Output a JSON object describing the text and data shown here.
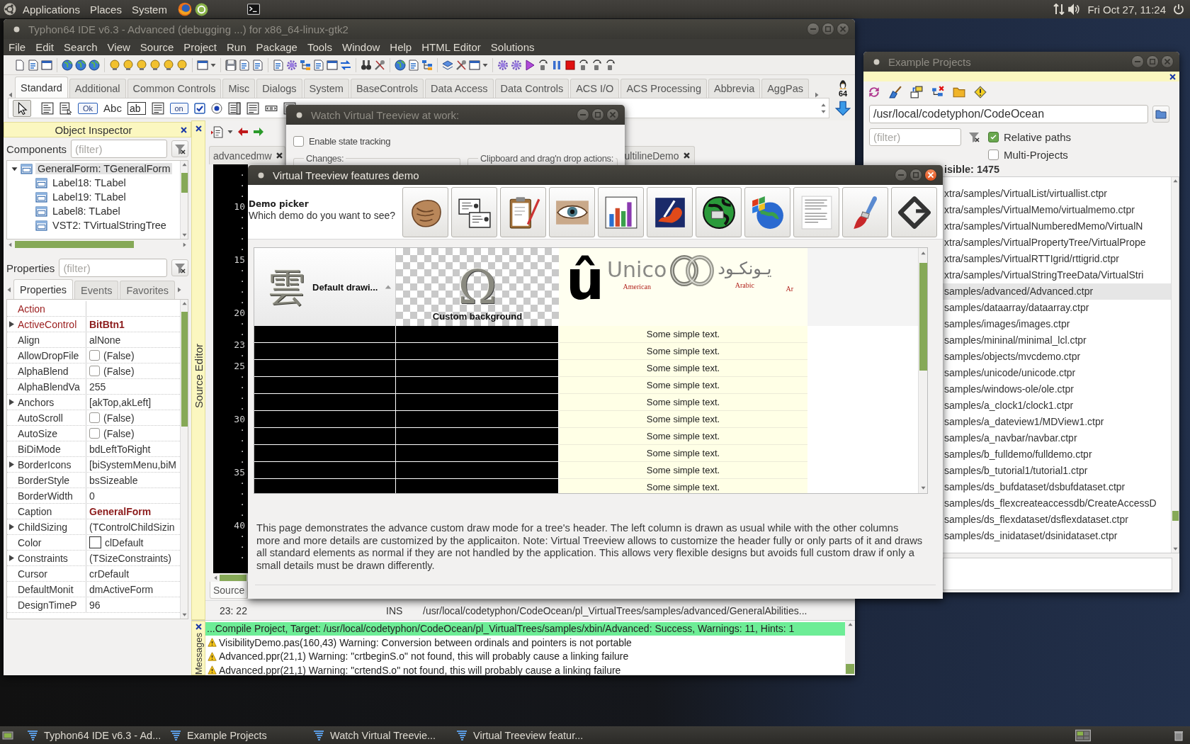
{
  "top_panel": {
    "menus": [
      "Applications",
      "Places",
      "System"
    ],
    "clock": "Fri Oct 27, 11:24"
  },
  "ide": {
    "title": "Typhon64 IDE v6.3 - Advanced (debugging ...) for x86_64-linux-gtk2",
    "active": false,
    "menu": [
      "File",
      "Edit",
      "Search",
      "View",
      "Source",
      "Project",
      "Run",
      "Package",
      "Tools",
      "Window",
      "Help",
      "HTML Editor",
      "Solutions"
    ],
    "palette_tabs": [
      {
        "label": "Standard",
        "selected": true
      },
      {
        "label": "Additional",
        "selected": false
      },
      {
        "label": "Common Controls",
        "selected": false
      },
      {
        "label": "Misc",
        "selected": false
      },
      {
        "label": "Dialogs",
        "selected": false
      },
      {
        "label": "System",
        "selected": false
      },
      {
        "label": "BaseControls",
        "selected": false
      },
      {
        "label": "Data Access",
        "selected": false
      },
      {
        "label": "Data Controls",
        "selected": false
      },
      {
        "label": "ACS I/O",
        "selected": false
      },
      {
        "label": "ACS Processing",
        "selected": false
      },
      {
        "label": "Abbrevia",
        "selected": false
      },
      {
        "label": "AggPas",
        "selected": false
      }
    ],
    "arch_badge": "64",
    "palette_items": [
      {
        "kind": "pointer"
      },
      {
        "kind": "main-menu"
      },
      {
        "kind": "popup-menu"
      },
      {
        "kind": "button",
        "text": "Ok"
      },
      {
        "kind": "label",
        "text": "Abc"
      },
      {
        "kind": "edit",
        "text": "ab"
      },
      {
        "kind": "memo"
      },
      {
        "kind": "toggle",
        "text": "on"
      },
      {
        "kind": "checkbox"
      },
      {
        "kind": "radio"
      },
      {
        "kind": "listbox"
      },
      {
        "kind": "memo"
      },
      {
        "kind": "scrollbar"
      },
      {
        "kind": "panel"
      }
    ],
    "object_inspector": {
      "title": "Object Inspector",
      "components_label": "Components",
      "components_filter": {
        "placeholder": "(filter)"
      },
      "tree": [
        {
          "label": "GeneralForm: TGeneralForm",
          "expanded": true,
          "selected": true,
          "children": [
            {
              "label": "Label18: TLabel",
              "selected": false
            },
            {
              "label": "Label19: TLabel",
              "selected": false
            },
            {
              "label": "Label8: TLabel",
              "selected": false
            },
            {
              "label": "VST2: TVirtualStringTree",
              "selected": false
            }
          ]
        }
      ],
      "properties_label": "Properties",
      "properties_filter": {
        "placeholder": "(filter)"
      },
      "tabs": [
        {
          "label": "Properties",
          "selected": true
        },
        {
          "label": "Events",
          "selected": false
        },
        {
          "label": "Favorites",
          "selected": false
        }
      ],
      "rows": [
        {
          "name": "Action",
          "kind": "text",
          "expandable": false,
          "linked": true,
          "modified": false
        },
        {
          "name": "ActiveControl",
          "value": "BitBtn1",
          "kind": "text",
          "expandable": true,
          "linked": true,
          "modified": true
        },
        {
          "name": "Align",
          "value": "alNone",
          "kind": "text",
          "expandable": false,
          "linked": false,
          "modified": false
        },
        {
          "name": "AllowDropFile",
          "value": "(False)",
          "kind": "checkbox",
          "checked": false,
          "expandable": false,
          "linked": false,
          "modified": false
        },
        {
          "name": "AlphaBlend",
          "value": "(False)",
          "kind": "checkbox",
          "checked": false,
          "expandable": false,
          "linked": false,
          "modified": false
        },
        {
          "name": "AlphaBlendVa",
          "value": "255",
          "kind": "text",
          "expandable": false,
          "linked": false,
          "modified": false
        },
        {
          "name": "Anchors",
          "value": "[akTop,akLeft]",
          "kind": "text",
          "expandable": true,
          "linked": false,
          "modified": false
        },
        {
          "name": "AutoScroll",
          "value": "(False)",
          "kind": "checkbox",
          "checked": false,
          "expandable": false,
          "linked": false,
          "modified": false
        },
        {
          "name": "AutoSize",
          "value": "(False)",
          "kind": "checkbox",
          "checked": false,
          "expandable": false,
          "linked": false,
          "modified": false
        },
        {
          "name": "BiDiMode",
          "value": "bdLeftToRight",
          "kind": "text",
          "expandable": false,
          "linked": false,
          "modified": false
        },
        {
          "name": "BorderIcons",
          "value": "[biSystemMenu,biM",
          "kind": "text",
          "expandable": true,
          "linked": false,
          "modified": false
        },
        {
          "name": "BorderStyle",
          "value": "bsSizeable",
          "kind": "text",
          "expandable": false,
          "linked": false,
          "modified": false
        },
        {
          "name": "BorderWidth",
          "value": "0",
          "kind": "text",
          "expandable": false,
          "linked": false,
          "modified": false
        },
        {
          "name": "Caption",
          "value": "GeneralForm",
          "kind": "text",
          "expandable": false,
          "linked": false,
          "modified": true
        },
        {
          "name": "ChildSizing",
          "value": "(TControlChildSizin",
          "kind": "text",
          "expandable": true,
          "linked": false,
          "modified": false
        },
        {
          "name": "Color",
          "value": "clDefault",
          "kind": "color",
          "expandable": false,
          "linked": false,
          "modified": false
        },
        {
          "name": "Constraints",
          "value": "(TSizeConstraints)",
          "kind": "text",
          "expandable": true,
          "linked": false,
          "modified": false
        },
        {
          "name": "Cursor",
          "value": "crDefault",
          "kind": "text",
          "expandable": false,
          "linked": false,
          "modified": false
        },
        {
          "name": "DefaultMonit",
          "value": "dmActiveForm",
          "kind": "text",
          "expandable": false,
          "linked": false,
          "modified": false
        },
        {
          "name": "DesignTimeP",
          "value": "96",
          "kind": "text",
          "expandable": false,
          "linked": false,
          "modified": false
        }
      ]
    },
    "source_editor": {
      "side_label": "Source Editor",
      "tabs": [
        {
          "label": "advancedmw"
        },
        {
          "label": "ultilineDemo"
        }
      ],
      "gutter": [
        "·",
        "·",
        "·",
        "10",
        "·",
        "·",
        "·",
        "·",
        "15",
        "·",
        "·",
        "·",
        "·",
        "20",
        "·",
        "·",
        "23",
        "·",
        "25",
        "·",
        "·",
        "·",
        "·",
        "30",
        "·",
        "·",
        "·",
        "·",
        "35",
        "·",
        "·",
        "·",
        "·",
        "40",
        "·",
        "·",
        "·"
      ],
      "bottom_tab": "Source",
      "status": {
        "position": "23: 22",
        "mode": "INS",
        "file": "/usr/local/codetyphon/CodeOcean/pl_VirtualTrees/samples/advanced/GeneralAbilities..."
      }
    },
    "messages": {
      "side_label": "Messages",
      "lines": [
        {
          "kind": "success",
          "text": "...Compile Project, Target: /usr/local/codetyphon/CodeOcean/pl_VirtualTrees/samples/xbin/Advanced: Success, Warnings: 11, Hints: 1"
        },
        {
          "kind": "warning",
          "text": "VisibilityDemo.pas(160,43) Warning: Conversion between ordinals and pointers is not portable"
        },
        {
          "kind": "warning",
          "text": "Advanced.ppr(21,1) Warning: \"crtbeginS.o\" not found, this will probably cause a linking failure"
        },
        {
          "kind": "warning",
          "text": "Advanced.ppr(21,1) Warning: \"crtendS.o\" not found, this will probably cause a linking failure"
        }
      ]
    }
  },
  "example_projects": {
    "title": "Example Projects",
    "active": false,
    "path": "/usr/local/codetyphon/CodeOcean",
    "filter": {
      "placeholder": "(filter)"
    },
    "relative_paths": {
      "label": "Relative paths",
      "checked": true
    },
    "multi_projects": {
      "label": "Multi-Projects",
      "checked": false
    },
    "visible_count": "isible: 1475",
    "items": [
      {
        "path": "xtra/samples/VirtualList/virtuallist.ctpr",
        "selected": false
      },
      {
        "path": "xtra/samples/VirtualMemo/virtualmemo.ctpr",
        "selected": false
      },
      {
        "path": "xtra/samples/VirtualNumberedMemo/VirtualN",
        "selected": false
      },
      {
        "path": "xtra/samples/VirtualPropertyTree/VirtualPrope",
        "selected": false
      },
      {
        "path": "xtra/samples/VirtualRTTIgrid/rttigrid.ctpr",
        "selected": false
      },
      {
        "path": "xtra/samples/VirtualStringTreeData/VirtualStri",
        "selected": false
      },
      {
        "path": "samples/advanced/Advanced.ctpr",
        "selected": true
      },
      {
        "path": "samples/dataarray/dataarray.ctpr",
        "selected": false
      },
      {
        "path": "samples/images/images.ctpr",
        "selected": false
      },
      {
        "path": "samples/mininal/minimal_lcl.ctpr",
        "selected": false
      },
      {
        "path": "samples/objects/mvcdemo.ctpr",
        "selected": false
      },
      {
        "path": "samples/unicode/unicode.ctpr",
        "selected": false
      },
      {
        "path": "samples/windows-ole/ole.ctpr",
        "selected": false
      },
      {
        "path": "samples/a_clock1/clock1.ctpr",
        "selected": false
      },
      {
        "path": "samples/a_dateview1/MDView1.ctpr",
        "selected": false
      },
      {
        "path": "samples/a_navbar/navbar.ctpr",
        "selected": false
      },
      {
        "path": "samples/b_fulldemo/fulldemo.ctpr",
        "selected": false
      },
      {
        "path": "samples/b_tutorial1/tutorial1.ctpr",
        "selected": false
      },
      {
        "path": "samples/ds_bufdataset/dsbufdataset.ctpr",
        "selected": false
      },
      {
        "path": "samples/ds_flexcreateaccessdb/CreateAccessD",
        "selected": false
      },
      {
        "path": "samples/ds_flexdataset/dsflexdataset.ctpr",
        "selected": false
      },
      {
        "path": "samples/ds_inidataset/dsinidataset.ctpr",
        "selected": false
      }
    ]
  },
  "watch_window": {
    "title": "Watch Virtual Treeview at work:",
    "active": false,
    "state_tracking": {
      "label": "Enable state tracking",
      "checked": false
    },
    "groups": [
      "Changes:",
      "Clipboard and drag'n drop actions:"
    ]
  },
  "demo_window": {
    "title": "Virtual Treeview features demo",
    "active": true,
    "picker_title": "Demo picker",
    "picker_question": "Which demo do you want to see?",
    "columns": [
      {
        "kind": "default",
        "glyph": "雲",
        "label": "Default drawi...",
        "sorted": true
      },
      {
        "kind": "custom-background",
        "glyph": "Ω",
        "label": "Custom background",
        "sorted": false
      },
      {
        "kind": "custom-art",
        "glyph": "û",
        "labels": [
          {
            "word": "Unico",
            "caption": "American"
          },
          {
            "word": "يـونكـود",
            "caption": "Arabic"
          },
          {
            "caption": "Ar"
          }
        ],
        "sorted": false
      }
    ],
    "rows": [
      "Some simple text.",
      "Some simple text.",
      "Some simple text.",
      "Some simple text.",
      "Some simple text.",
      "Some simple text.",
      "Some simple text.",
      "Some simple text.",
      "Some simple text.",
      "Some simple text."
    ],
    "description": "This page demonstrates the advance custom draw mode for a tree's header. The left column is drawn as usual while with the other columns more and more details are customized by the applicaiton. Note: Virtual Treeview allows to customize the header fully or only parts of it and draws all standard elements as normal if they are not handled by the application. This allows very flexible designs but avoids full custom draw if only a small details must be drawn differently."
  },
  "taskbar": {
    "items": [
      "Typhon64 IDE v6.3 - Ad...",
      "Example Projects",
      "Watch Virtual Treevie...",
      "Virtual Treeview featur..."
    ]
  }
}
